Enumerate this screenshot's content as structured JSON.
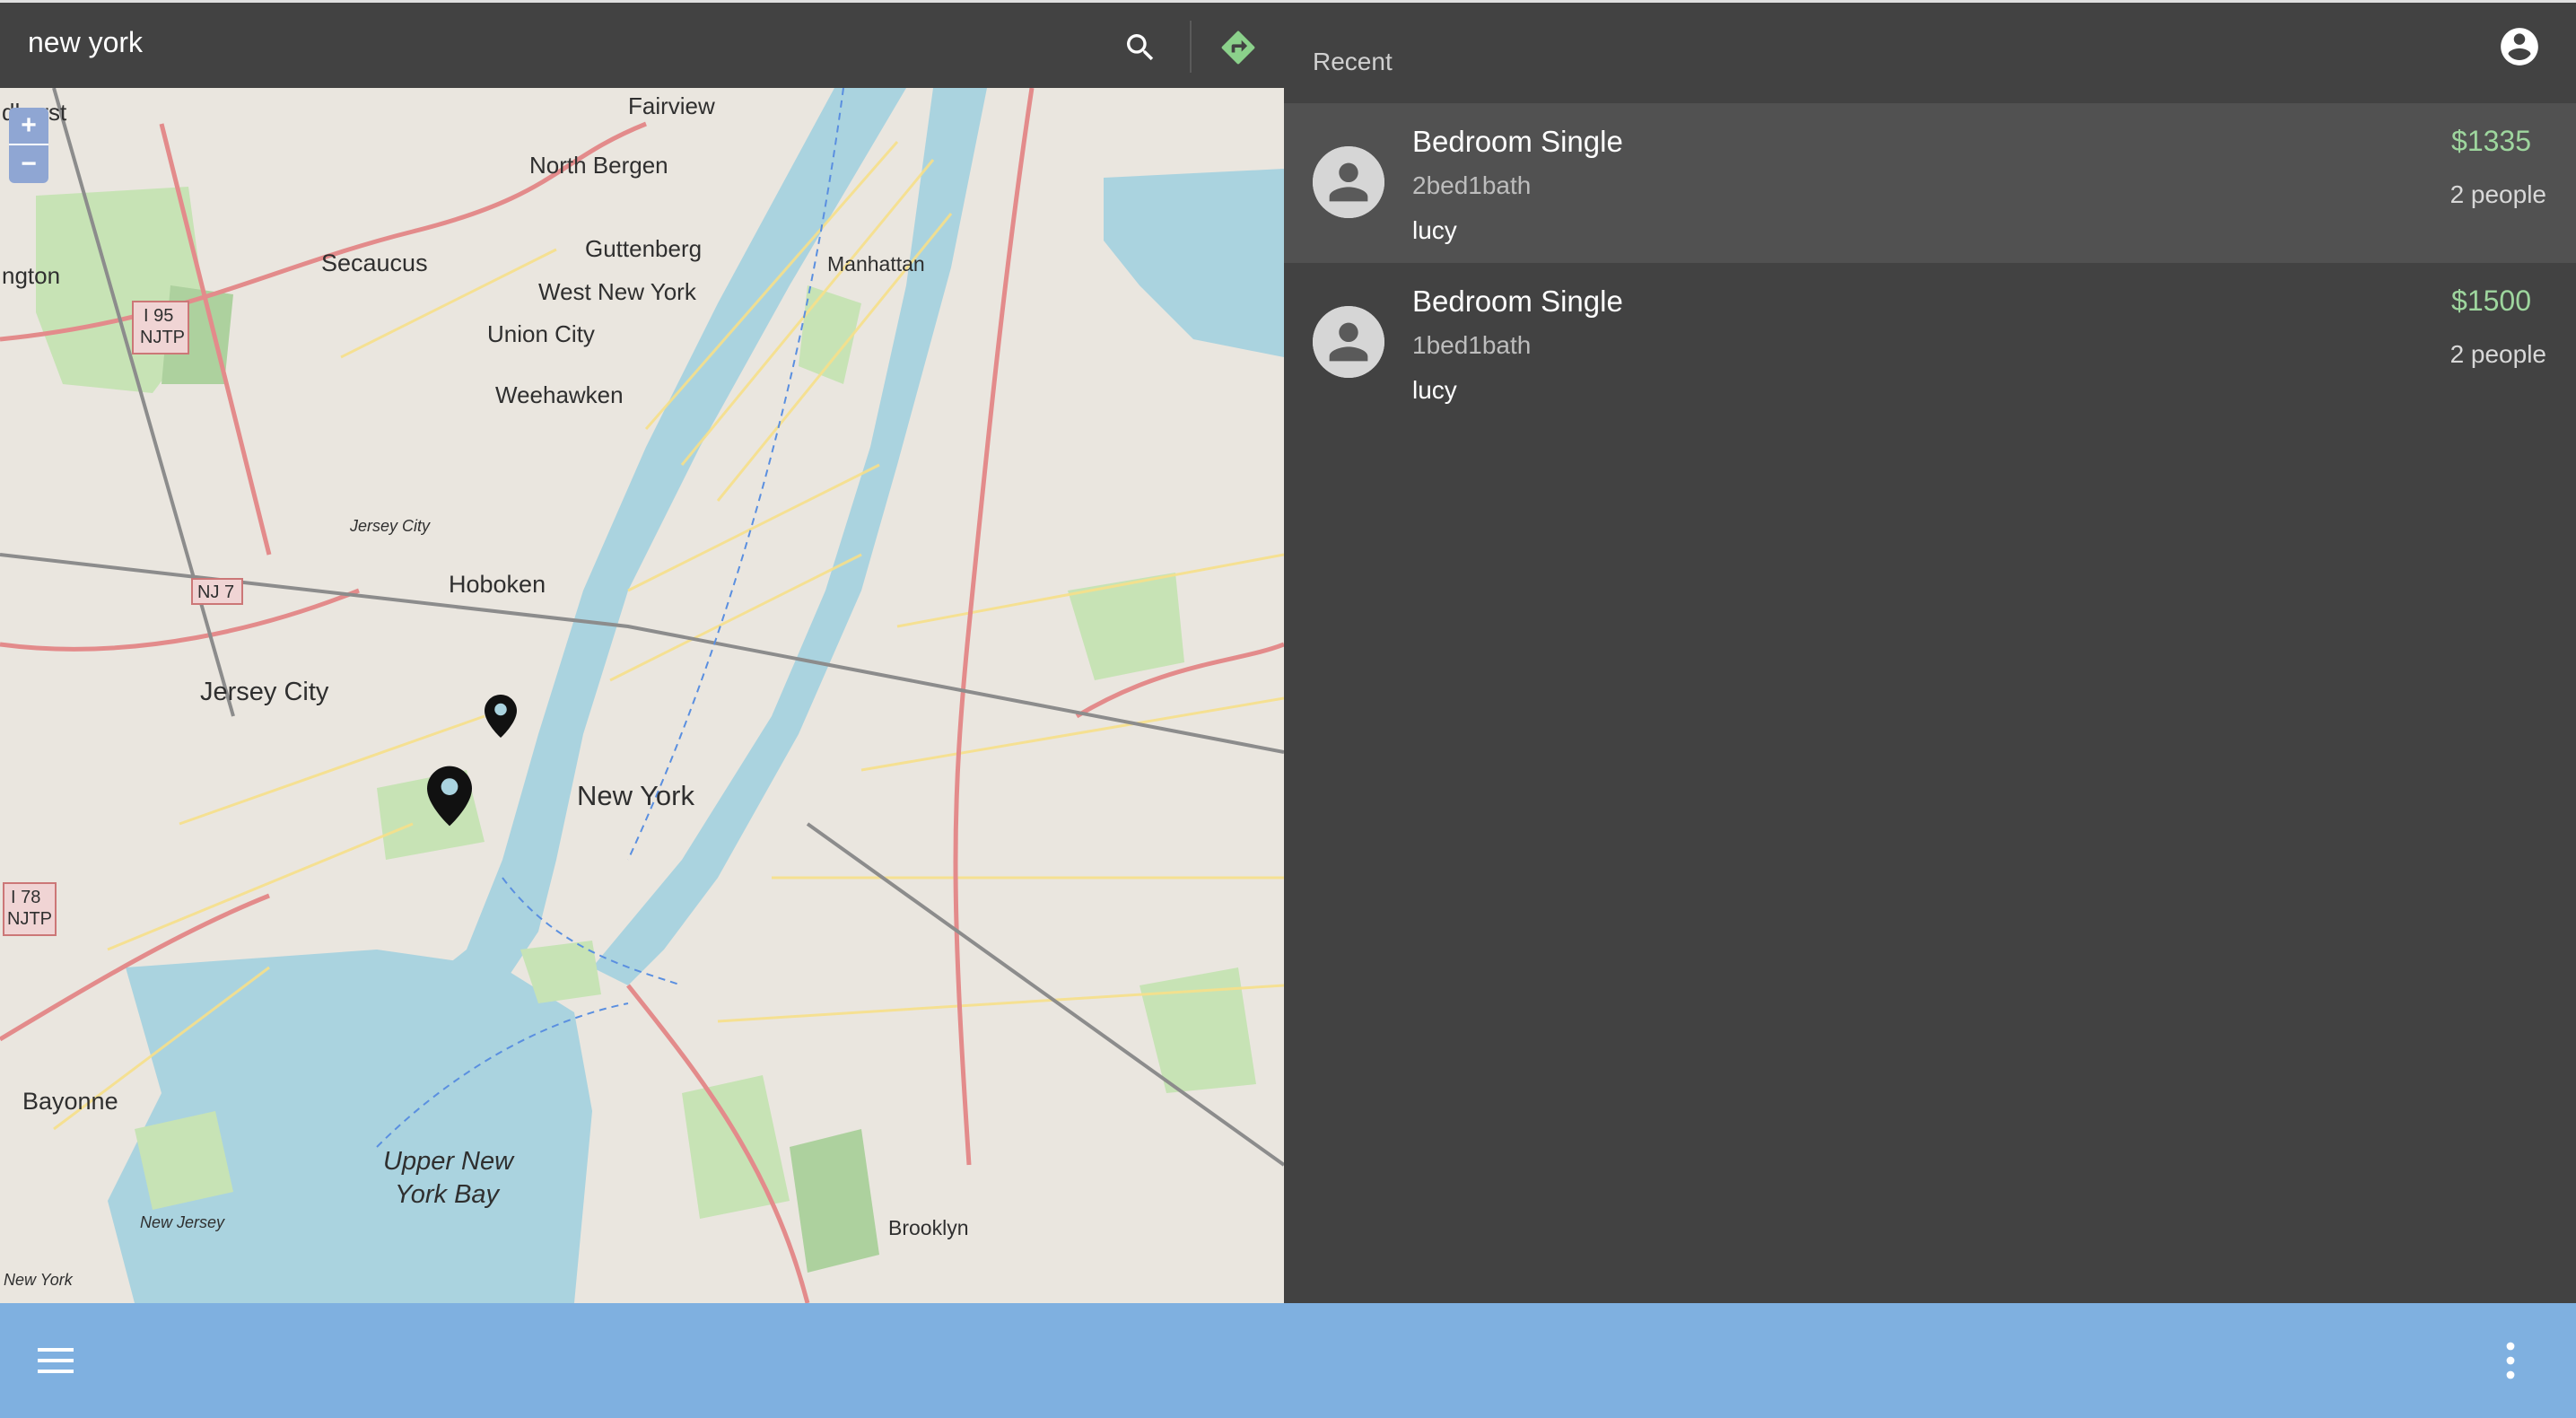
{
  "search": {
    "query": "new york"
  },
  "map": {
    "zoom_in_label": "+",
    "zoom_out_label": "−",
    "labels": {
      "fairview": "Fairview",
      "north_bergen": "North Bergen",
      "guttenberg": "Guttenberg",
      "secaucus": "Secaucus",
      "west_new_york": "West New York",
      "union_city": "Union City",
      "weehawken": "Weehawken",
      "manhattan": "Manhattan",
      "hoboken": "Hoboken",
      "jersey_city": "Jersey City",
      "new_york": "New York",
      "bayonne": "Bayonne",
      "upper_bay_1": "Upper New",
      "upper_bay_2": "York Bay",
      "brooklyn": "Brooklyn",
      "i95_a": "I 95",
      "i95_b": "NJTP",
      "i78_a": "I 78",
      "i78_b": "NJTP",
      "nj7": "NJ 7",
      "jersey_city_small": "Jersey City",
      "new_jersey": "New Jersey",
      "new_york_small": "New York",
      "edge_hurst": "dhurst",
      "edge_ngton": "ngton"
    }
  },
  "sidebar": {
    "header_label": "Recent",
    "items": [
      {
        "title": "Bedroom Single",
        "subtitle": "2bed1bath",
        "user": "lucy",
        "price": "$1335",
        "people": "2 people",
        "selected": true
      },
      {
        "title": "Bedroom Single",
        "subtitle": "1bed1bath",
        "user": "lucy",
        "price": "$1500",
        "people": "2 people",
        "selected": false
      }
    ]
  },
  "icons": {
    "search": "search-icon",
    "directions": "directions-icon",
    "account": "account-circle-icon",
    "avatar": "person-icon",
    "menu": "menu-icon",
    "more": "more-vert-icon",
    "marker": "map-pin-icon"
  },
  "colors": {
    "dark_panel": "#424242",
    "selected_row": "#515151",
    "price_green": "#9ed69e",
    "bottom_bar": "#7fb0e0",
    "directions_green": "#8bd18b"
  }
}
